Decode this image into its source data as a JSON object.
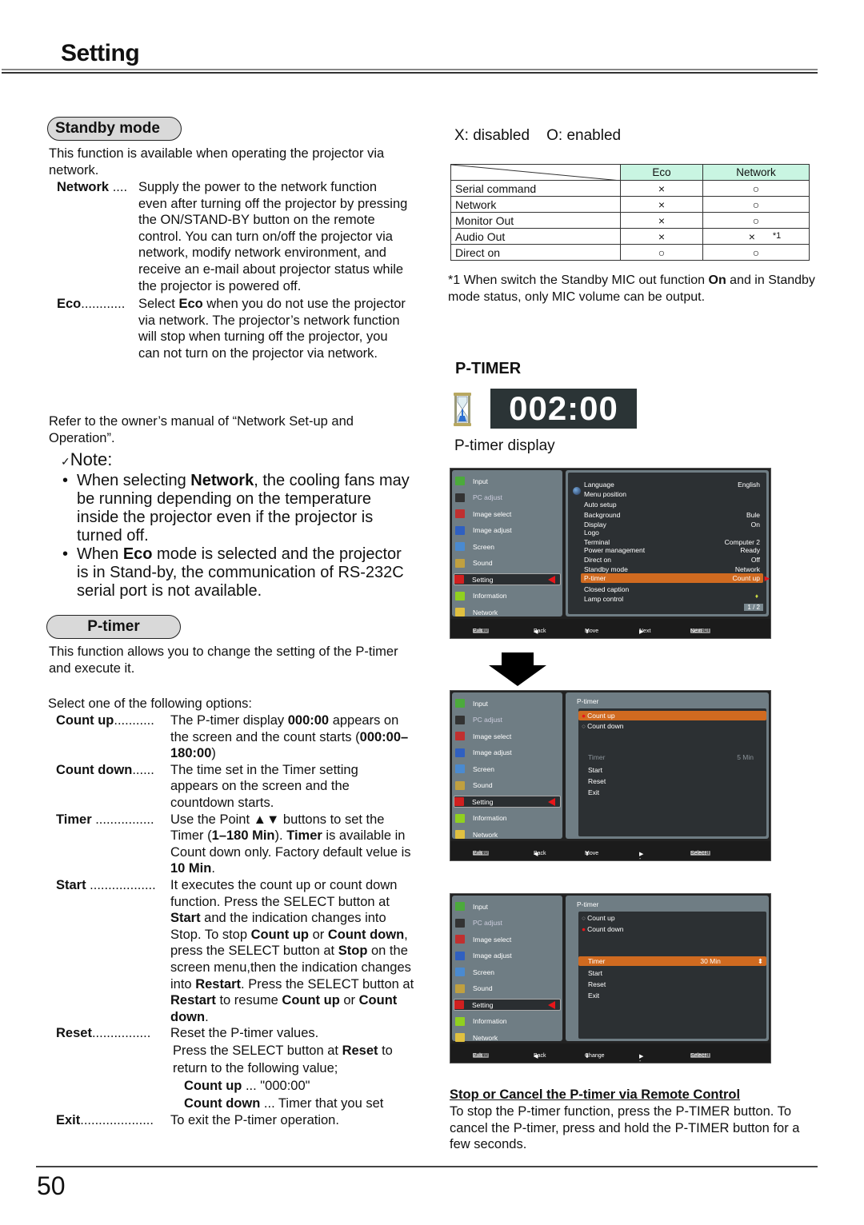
{
  "header": {
    "title": "Setting"
  },
  "footer": {
    "page_number": "50"
  },
  "standby": {
    "heading": "Standby mode",
    "intro": "This function is available when operating the projector via network.",
    "options": [
      {
        "term": "Network",
        "dots": " ....",
        "definition": "Supply the power to the network function even after turning off the projector by pressing the ON/STAND-BY button on the remote control. You can turn on/off the projector via network, modify network environment, and receive an e-mail about projector status while the projector is powered off."
      },
      {
        "term": "Eco",
        "dots": "............",
        "def_pre": "Select ",
        "def_bold": "Eco",
        "def_post": " when you do not use the projector via network. The projector’s network function will stop when turning off the projector, you can not turn on the projector via network."
      }
    ],
    "refer": "Refer to the owner’s manual of “Network Set-up and Operation”.",
    "note": {
      "title": "Note:",
      "check_icon": "✓",
      "bullets": [
        {
          "pre": "When selecting ",
          "bold": "Network",
          "post": ", the cooling fans may be running depending on the temperature inside the projector even if  the projector is turned off."
        },
        {
          "pre": "When ",
          "bold": "Eco",
          "post": " mode is selected and the projector is in Stand-by, the communication of RS-232C serial port is not available."
        }
      ]
    }
  },
  "ptimer_section": {
    "heading": "P-timer",
    "intro": "This function allows you to change the setting of the P-timer and execute it.",
    "select_prompt": "Select one of the following options:",
    "options": [
      {
        "term": "Count up",
        "dots": "..........."
      },
      {
        "term": "Count down",
        "dots": "......"
      },
      {
        "term": "Timer",
        "dots": " ................"
      },
      {
        "term": "Start",
        "dots": " .................."
      },
      {
        "term": "Reset",
        "dots": "................"
      },
      {
        "term": "Exit",
        "dots": "...................."
      }
    ],
    "countup_def": {
      "a": "The P-timer display ",
      "b": "000:00",
      "c": " appears on the screen and the count starts (",
      "d": "000:00–180:00",
      "e": ")"
    },
    "countdown_def": "The time set in the Timer setting appears on the screen and the countdown starts.",
    "timer_def": {
      "a": "Use the Point ▲▼ buttons to set the Timer (",
      "b": "1–180 Min",
      "c": "). ",
      "d": "Timer",
      "e": " is available in Count down only. Factory default velue is ",
      "f": "10 Min",
      "g": "."
    },
    "start_def": {
      "a": "It executes the count up or count down function. Press the SELECT button at ",
      "b": "Start",
      "c": " and the indication changes into Stop. To stop ",
      "d": "Count up",
      "e": " or ",
      "f": "Count down",
      "g": ", press the SELECT button at ",
      "h": "Stop",
      "i": " on the screen menu,then the indication changes into ",
      "j": "Restart",
      "k": ". Press the SELECT button at ",
      "l": "Restart",
      "m": " to resume ",
      "n": "Count up",
      "o": " or ",
      "p": "Count down",
      "q": "."
    },
    "reset_def": {
      "a": "Reset the P-timer values.",
      "b": "Press the SELECT button at ",
      "c": "Reset",
      "d": " to return to the following value;",
      "cu_term": "Count up",
      "cu_val": " ... \"000:00\"",
      "cd_term": "Count down",
      "cd_val": " ... Timer that you set"
    },
    "exit_def": "To exit the P-timer operation."
  },
  "table": {
    "legend": "X: disabled    O: enabled",
    "columns": [
      "Eco",
      "Network"
    ],
    "rows": [
      {
        "label": "Serial command",
        "eco": "×",
        "network": "○"
      },
      {
        "label": "Network",
        "eco": "×",
        "network": "○"
      },
      {
        "label": "Monitor Out",
        "eco": "×",
        "network": "○"
      },
      {
        "label": "Audio Out",
        "eco": "×",
        "network": "×",
        "note": "*1"
      },
      {
        "label": "Direct on",
        "eco": "○",
        "network": "○"
      }
    ],
    "footnote": {
      "mark": "*1",
      "a": " When switch the Standby MIC out function ",
      "b": "On",
      "c": " and in Standby mode status, only MIC volume can be output."
    }
  },
  "ptimer_display": {
    "heading": "P-TIMER",
    "icon": "hourglass-icon",
    "value": "002:00",
    "caption": "P-timer display"
  },
  "osd_left_menu": [
    {
      "label": "Input",
      "icon": "input-icon",
      "color": "#4caa3c"
    },
    {
      "label": "PC adjust",
      "icon": "pc-adjust-icon",
      "color": "#333",
      "dim": true
    },
    {
      "label": "Image select",
      "icon": "image-select-icon",
      "color": "#c03030"
    },
    {
      "label": "Image adjust",
      "icon": "image-adjust-icon",
      "color": "#3060c0"
    },
    {
      "label": "Screen",
      "icon": "screen-icon",
      "color": "#4a8ad0"
    },
    {
      "label": "Sound",
      "icon": "sound-icon",
      "color": "#c0a040"
    },
    {
      "label": "Setting",
      "icon": "setting-icon",
      "color": "#d02020",
      "selected": true
    },
    {
      "label": "Information",
      "icon": "information-icon",
      "color": "#90d020"
    },
    {
      "label": "Network",
      "icon": "network-icon",
      "color": "#e0c040"
    }
  ],
  "osd1": {
    "items": [
      {
        "label": "Language",
        "value": "English"
      },
      {
        "label": "Menu position",
        "value": ""
      },
      {
        "label": "Auto setup",
        "value": ""
      },
      {
        "label": "Background",
        "value": "Bule"
      },
      {
        "label": "Display",
        "value": "On"
      },
      {
        "label": "Logo",
        "value": ""
      },
      {
        "label": "Terminal",
        "value": "Computer 2"
      },
      {
        "label": "Power management",
        "value": "Ready"
      },
      {
        "label": "Direct on",
        "value": "Off"
      },
      {
        "label": "Standby mode",
        "value": "Network"
      },
      {
        "label": "P-timer",
        "value": "Count up",
        "highlight": true
      },
      {
        "label": "Closed caption",
        "value": ""
      },
      {
        "label": "Lamp control",
        "value": ""
      }
    ],
    "page": "1 / 2",
    "bar": [
      {
        "key": "MENU",
        "label": "Exit"
      },
      {
        "key": "◀",
        "label": "Back"
      },
      {
        "key": "⬍",
        "label": "Move"
      },
      {
        "key": "▶",
        "label": "Next"
      },
      {
        "key": "SELECT",
        "label": "Next"
      }
    ]
  },
  "osd2": {
    "title": "P-timer",
    "options": [
      {
        "label": "Count up",
        "selected": true,
        "highlight": true
      },
      {
        "label": "Count down",
        "selected": false
      }
    ],
    "timer": {
      "label": "Timer",
      "value": "5 Min",
      "disabled": true
    },
    "actions": [
      "Start",
      "Reset",
      "Exit"
    ],
    "bar": [
      {
        "key": "MENU",
        "label": "Exit"
      },
      {
        "key": "◀",
        "label": "Back"
      },
      {
        "key": "⬍",
        "label": "Move"
      },
      {
        "key": "▶",
        "label": "-----"
      },
      {
        "key": "SELECT",
        "label": "Select"
      }
    ]
  },
  "osd3": {
    "title": "P-timer",
    "options": [
      {
        "label": "Count up",
        "selected": false
      },
      {
        "label": "Count down",
        "selected": true
      }
    ],
    "timer": {
      "label": "Timer",
      "value": "30 Min",
      "highlight": true
    },
    "actions": [
      "Start",
      "Reset",
      "Exit"
    ],
    "bar": [
      {
        "key": "MENU",
        "label": "Exit"
      },
      {
        "key": "◀",
        "label": "Back"
      },
      {
        "key": "⬍",
        "label": "Change"
      },
      {
        "key": "▶",
        "label": "-----"
      },
      {
        "key": "SELECT",
        "label": "Select"
      }
    ]
  },
  "remote": {
    "heading": "Stop or Cancel the P-timer via Remote Control",
    "text": "To stop the P-timer function, press the P-TIMER button. To cancel the P-timer, press and hold the P-TIMER button for a few seconds."
  },
  "colors": {
    "highlight": "#d06a20",
    "table_header": "#c9f5e2",
    "timer_bg": "#2b3436",
    "osd_panel": "#6f7d84"
  }
}
